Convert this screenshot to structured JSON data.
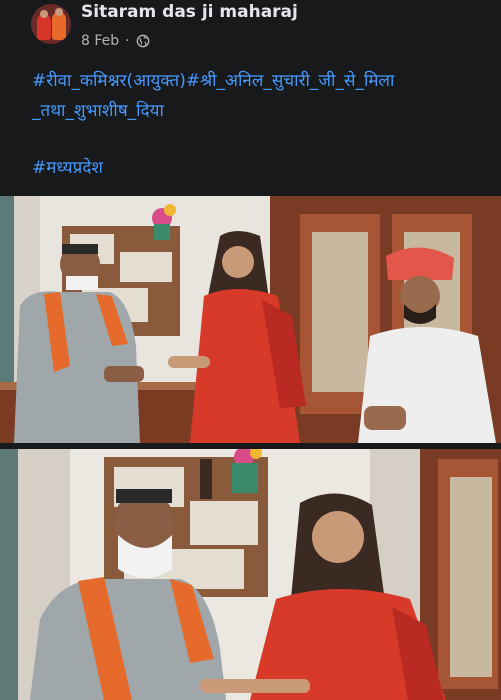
{
  "post": {
    "author": "Sitaram das ji maharaj",
    "date": "8 Feb",
    "separator": "·",
    "privacy_icon": "globe-icon",
    "text_line1": "#रीवा_कमिश्नर(आयुक्त)#श्री_अनिल_सुचारी_जी_से_मिला",
    "text_line2": "_तथा_शुभाशीष_दिया",
    "hashtag": "#मध्यप्रदेश"
  },
  "colors": {
    "background": "#18191a",
    "link": "#4599ff",
    "name": "#e4e6eb",
    "meta": "#b0b3b8"
  },
  "photos": [
    {
      "name": "photo-meeting-1"
    },
    {
      "name": "photo-meeting-2"
    }
  ]
}
